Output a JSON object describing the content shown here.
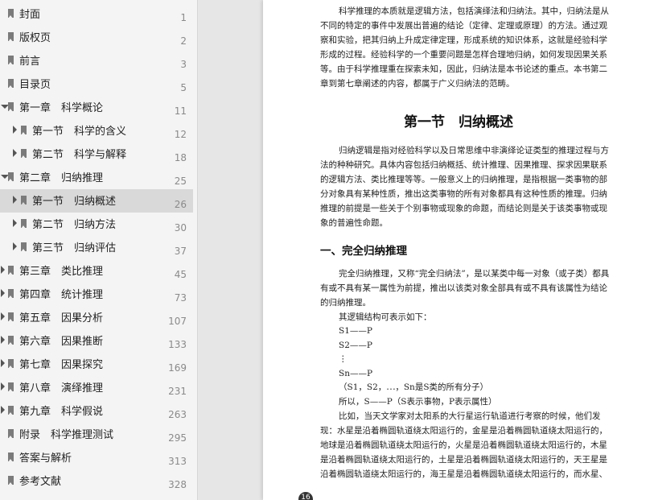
{
  "toc": [
    {
      "label": "封面",
      "page": "1"
    },
    {
      "label": "版权页",
      "page": "2"
    },
    {
      "label": "前言",
      "page": "3"
    },
    {
      "label": "目录页",
      "page": "5"
    },
    {
      "label": "第一章　科学概论",
      "page": "11"
    },
    {
      "label": "第一节　科学的含义",
      "page": "12"
    },
    {
      "label": "第二节　科学与解释",
      "page": "18"
    },
    {
      "label": "第二章　归纳推理",
      "page": "25"
    },
    {
      "label": "第一节　归纳概述",
      "page": "26"
    },
    {
      "label": "第二节　归纳方法",
      "page": "30"
    },
    {
      "label": "第三节　归纳评估",
      "page": "37"
    },
    {
      "label": "第三章　类比推理",
      "page": "45"
    },
    {
      "label": "第四章　统计推理",
      "page": "73"
    },
    {
      "label": "第五章　因果分析",
      "page": "107"
    },
    {
      "label": "第六章　因果推断",
      "page": "133"
    },
    {
      "label": "第七章　因果探究",
      "page": "169"
    },
    {
      "label": "第八章　演绎推理",
      "page": "231"
    },
    {
      "label": "第九章　科学假说",
      "page": "263"
    },
    {
      "label": "附录　科学推理测试",
      "page": "295"
    },
    {
      "label": "答案与解析",
      "page": "313"
    },
    {
      "label": "参考文献",
      "page": "328"
    }
  ],
  "doc": {
    "p1": [
      "科学推理的本质就是逻辑方法，包括演绎法和归纳法。其中，归纳法是从",
      "不同的特定的事件中发展出普遍的结论（定律、定理或原理）的方法。通过观",
      "察和实验，把其归纳上升成定律定理，形成系统的知识体系，这就是经验科学",
      "形成的过程。经验科学的一个重要问题是怎样合理地归纳，如何发现因果关系",
      "等。由于科学推理重在探索未知，因此，归纳法是本书论述的重点。本书第二",
      "章到第七章阐述的内容，都属于广义归纳法的范畴。"
    ],
    "section_title": "第一节　归纳概述",
    "p2": [
      "归纳逻辑是指对经验科学以及日常思维中非演绎论证类型的推理过程与方",
      "法的种种研究。具体内容包括归纳概括、统计推理、因果推理、探求因果联系",
      "的逻辑方法、类比推理等等。一般意义上的归纳推理，是指根据一类事物的部",
      "分对象具有某种性质，推出这类事物的所有对象都具有这种性质的推理。归纳",
      "推理的前提是一些关于个别事物或现象的命题，而结论则是关于该类事物或现",
      "象的普遍性命题。"
    ],
    "subsection_title": "一、完全归纳推理",
    "p3": [
      "完全归纳推理，又称“完全归纳法”，是以某类中每一对象（或子类）都具",
      "有或不具有某一属性为前提，推出以该类对象全部具有或不具有该属性为结论",
      "的归纳推理。"
    ],
    "formula_intro": "其逻辑结构可表示如下：",
    "formula": [
      "S1——P",
      "S2——P",
      "⋮",
      "Sn——P",
      "（S1，S2，⋯，Sn是S类的所有分子）",
      "所以，S——P（S表示事物，P表示属性）"
    ],
    "p4": [
      "比如，当天文学家对太阳系的大行星运行轨道进行考察的时候，他们发",
      "现：水星是沿着椭圆轨道绕太阳运行的，金星是沿着椭圆轨道绕太阳运行的，",
      "地球是沿着椭圆轨道绕太阳运行的，火星是沿着椭圆轨道绕太阳运行的，木星",
      "是沿着椭圆轨道绕太阳运行的，土星是沿着椭圆轨道绕太阳运行的，天王星是",
      "沿着椭圆轨道绕太阳运行的，海王星是沿着椭圆轨道绕太阳运行的，而水星、"
    ],
    "page_number": "16"
  }
}
